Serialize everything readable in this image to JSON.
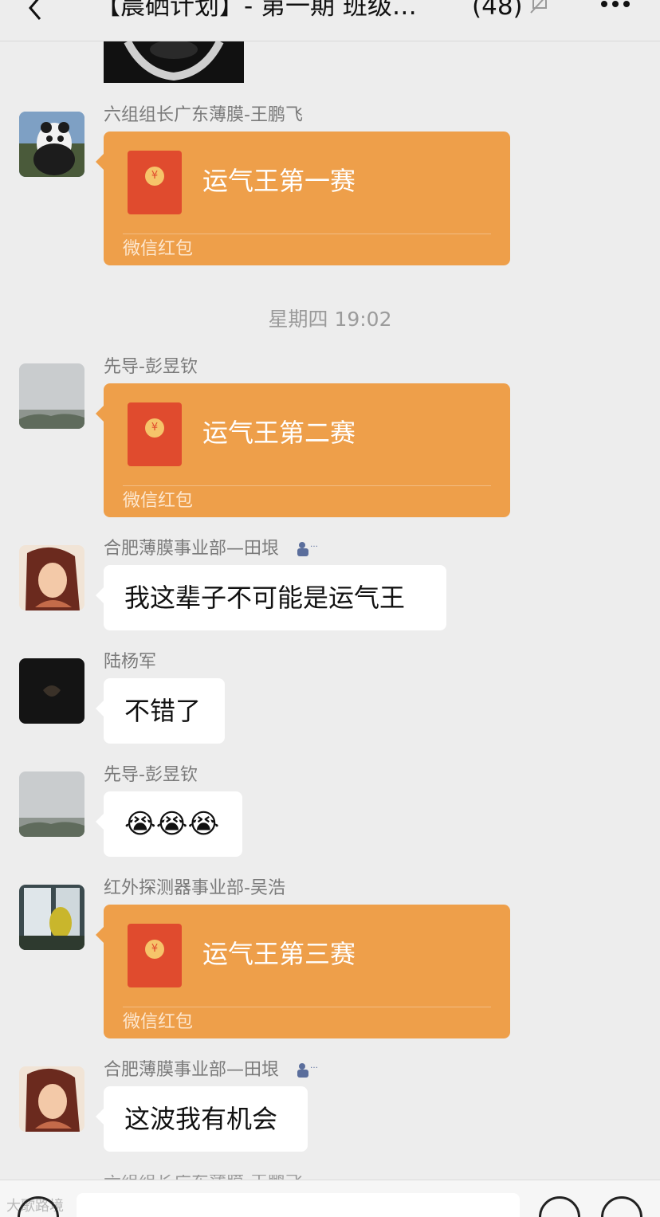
{
  "header": {
    "title": "【晨硒计划】- 第一期 班级…",
    "member_count": "(48)"
  },
  "timestamp": "星期四 19:02",
  "messages": [
    {
      "sender": "六组组长广东薄膜-王鹏飞",
      "type": "red_packet",
      "title": "运气王第一赛",
      "footer": "微信红包"
    },
    {
      "sender": "先导-彭昱钦",
      "type": "red_packet",
      "title": "运气王第二赛",
      "footer": "微信红包"
    },
    {
      "sender": "合肥薄膜事业部—田垠",
      "type": "text",
      "text": "我这辈子不可能是运气王"
    },
    {
      "sender": "陆杨军",
      "type": "text",
      "text": "不错了"
    },
    {
      "sender": "先导-彭昱钦",
      "type": "emoji",
      "text": "😭😭😭"
    },
    {
      "sender": "红外探测器事业部-吴浩",
      "type": "red_packet",
      "title": "运气王第三赛",
      "footer": "微信红包"
    },
    {
      "sender": "合肥薄膜事业部—田垠",
      "type": "text",
      "text": "这波我有机会"
    }
  ],
  "peek_sender": "六组组长广东薄膜-王鹏飞",
  "bottom_watermark": "大歌路境",
  "icons": {
    "back": "chevron-left-icon",
    "mute": "bell-off-icon",
    "more": "more-dots-icon",
    "voice": "voice-icon",
    "emoji": "emoji-icon",
    "add": "plus-icon"
  },
  "colors": {
    "background": "#ededed",
    "red_packet": "#ee9f4a",
    "bubble": "#ffffff"
  }
}
